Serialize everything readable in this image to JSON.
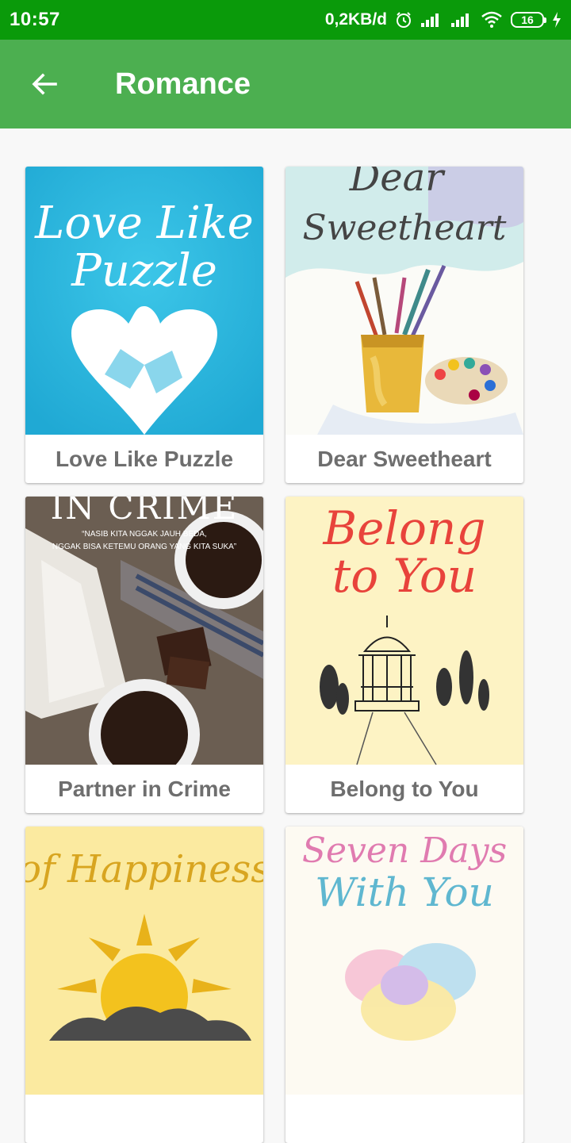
{
  "status_bar": {
    "time": "10:57",
    "network_speed": "0,2KB/d",
    "battery_level": "16"
  },
  "app_bar": {
    "title": "Romance"
  },
  "books": [
    {
      "title": "Love Like Puzzle",
      "cover_text": [
        "Love Like",
        "Puzzle"
      ]
    },
    {
      "title": "Dear Sweetheart",
      "cover_text": [
        "Dear",
        "Sweetheart"
      ]
    },
    {
      "title": "Partner in Crime",
      "cover_text": [
        "IN CRIME",
        "“NASIB KITA NGGAK JAUH BEDA,",
        "NGGAK BISA KETEMU ORANG YANG KITA SUKA”"
      ]
    },
    {
      "title": "Belong to You",
      "cover_text": [
        "Belong",
        "to You"
      ]
    },
    {
      "title": "",
      "cover_text": [
        "of Happiness"
      ]
    },
    {
      "title": "",
      "cover_text": [
        "Seven Days",
        "With You"
      ]
    }
  ],
  "colors": {
    "status_bar": "#0a9a0a",
    "app_bar": "#4caf50",
    "background": "#f8f8f8",
    "card_title": "#6e6e6e"
  }
}
